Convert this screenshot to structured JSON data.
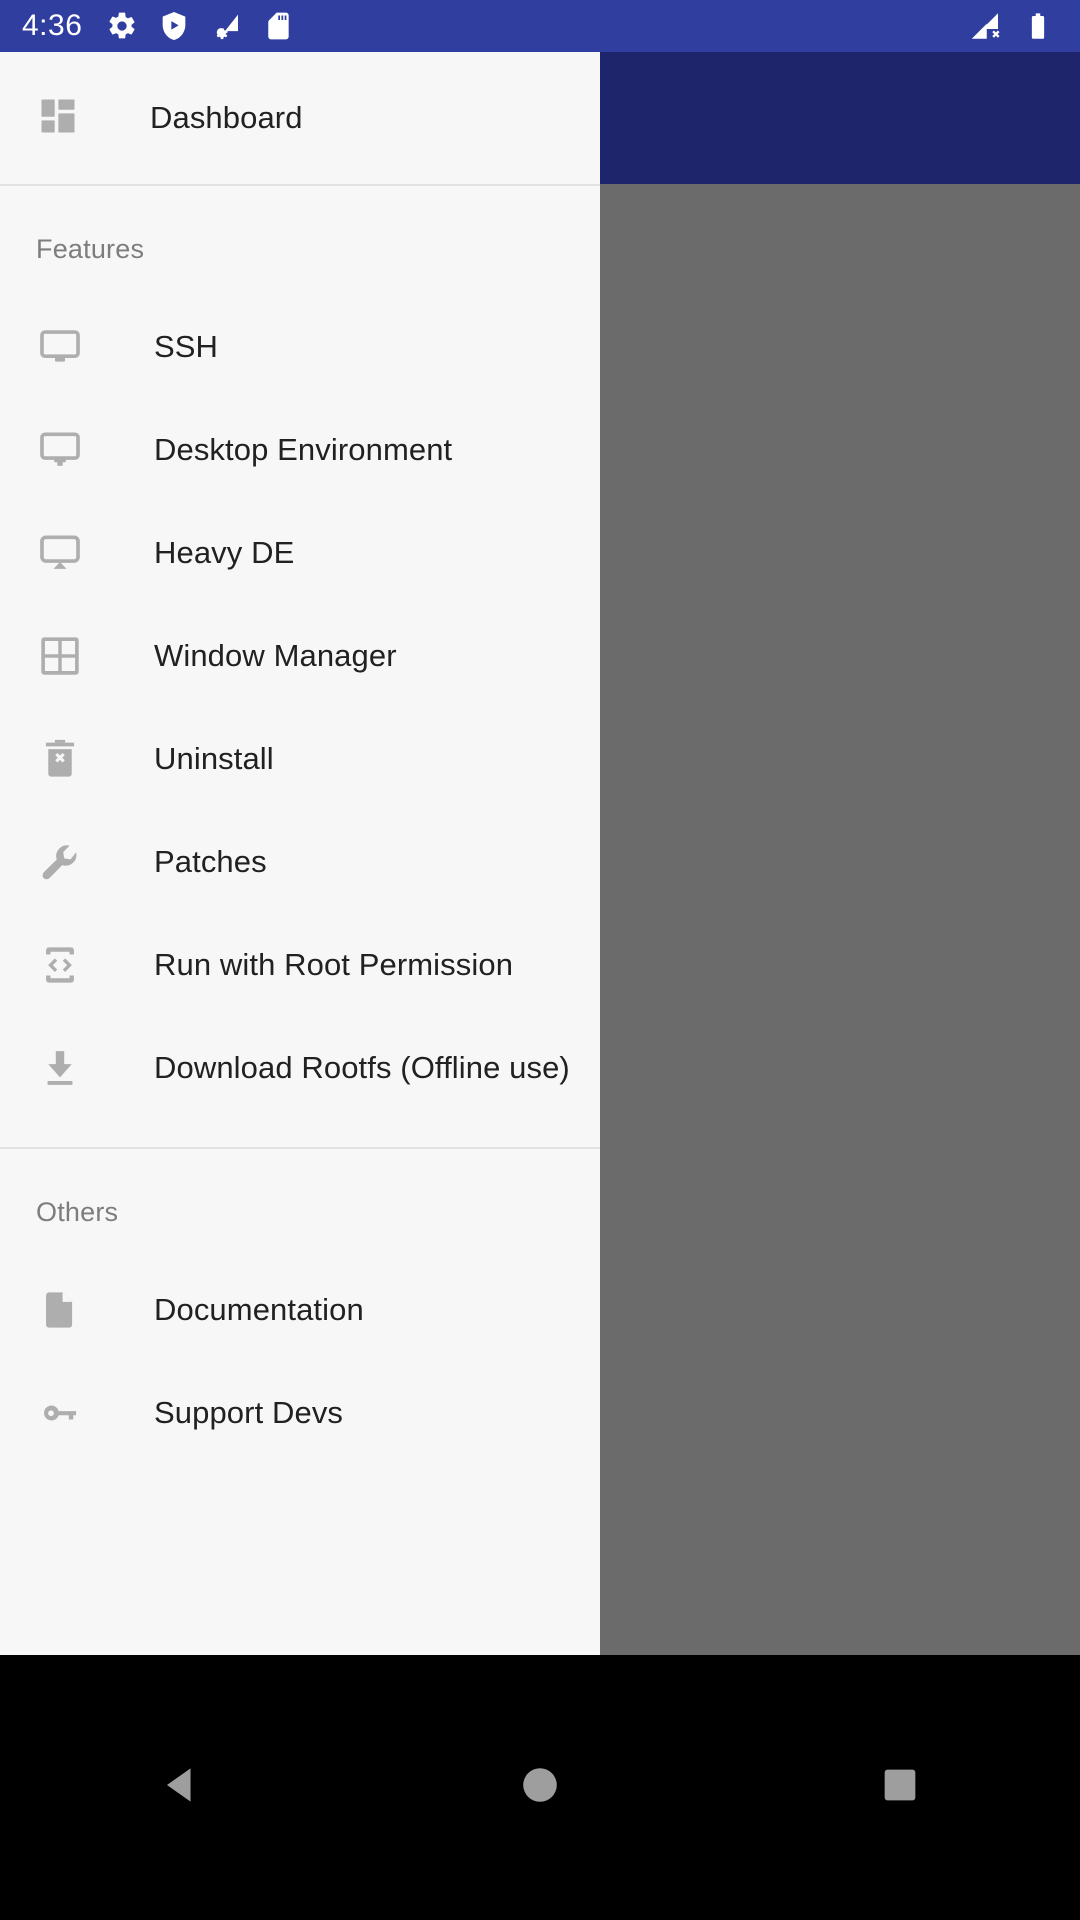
{
  "status_bar": {
    "time": "4:36",
    "background_color": "#303f9f",
    "left_icons": [
      {
        "name": "settings-gear-icon",
        "glyph": "gear"
      },
      {
        "name": "shield-play-icon",
        "glyph": "shield-play"
      },
      {
        "name": "wifi-settings-icon",
        "glyph": "wifi-gear"
      },
      {
        "name": "sd-card-icon",
        "glyph": "sdcard"
      }
    ],
    "right_icons": [
      {
        "name": "signal-off-icon",
        "glyph": "signal-x"
      },
      {
        "name": "battery-full-icon",
        "glyph": "battery"
      }
    ]
  },
  "drawer": {
    "background_color": "#f7f7f8",
    "header": {
      "label": "Dashboard",
      "icon": "dashboard-grid-icon"
    },
    "sections": [
      {
        "title": "Features",
        "items": [
          {
            "label": "SSH",
            "icon": "monitor-icon"
          },
          {
            "label": "Desktop Environment",
            "icon": "desktop-icon"
          },
          {
            "label": "Heavy DE",
            "icon": "monitor-rounded-icon"
          },
          {
            "label": "Window Manager",
            "icon": "grid-window-icon"
          },
          {
            "label": "Uninstall",
            "icon": "trash-delete-icon"
          },
          {
            "label": "Patches",
            "icon": "wrench-icon"
          },
          {
            "label": "Run with Root Permission",
            "icon": "developer-mode-icon"
          },
          {
            "label": "Download Rootfs (Offline use)",
            "icon": "download-icon"
          }
        ]
      },
      {
        "title": "Others",
        "items": [
          {
            "label": "Documentation",
            "icon": "document-icon"
          },
          {
            "label": "Support Devs",
            "icon": "key-icon"
          }
        ]
      }
    ]
  },
  "nav_bar": {
    "background_color": "#000000",
    "buttons": [
      {
        "name": "back-button",
        "icon": "back-triangle-icon"
      },
      {
        "name": "home-button",
        "icon": "home-circle-icon"
      },
      {
        "name": "recents-button",
        "icon": "recents-square-icon"
      }
    ]
  }
}
